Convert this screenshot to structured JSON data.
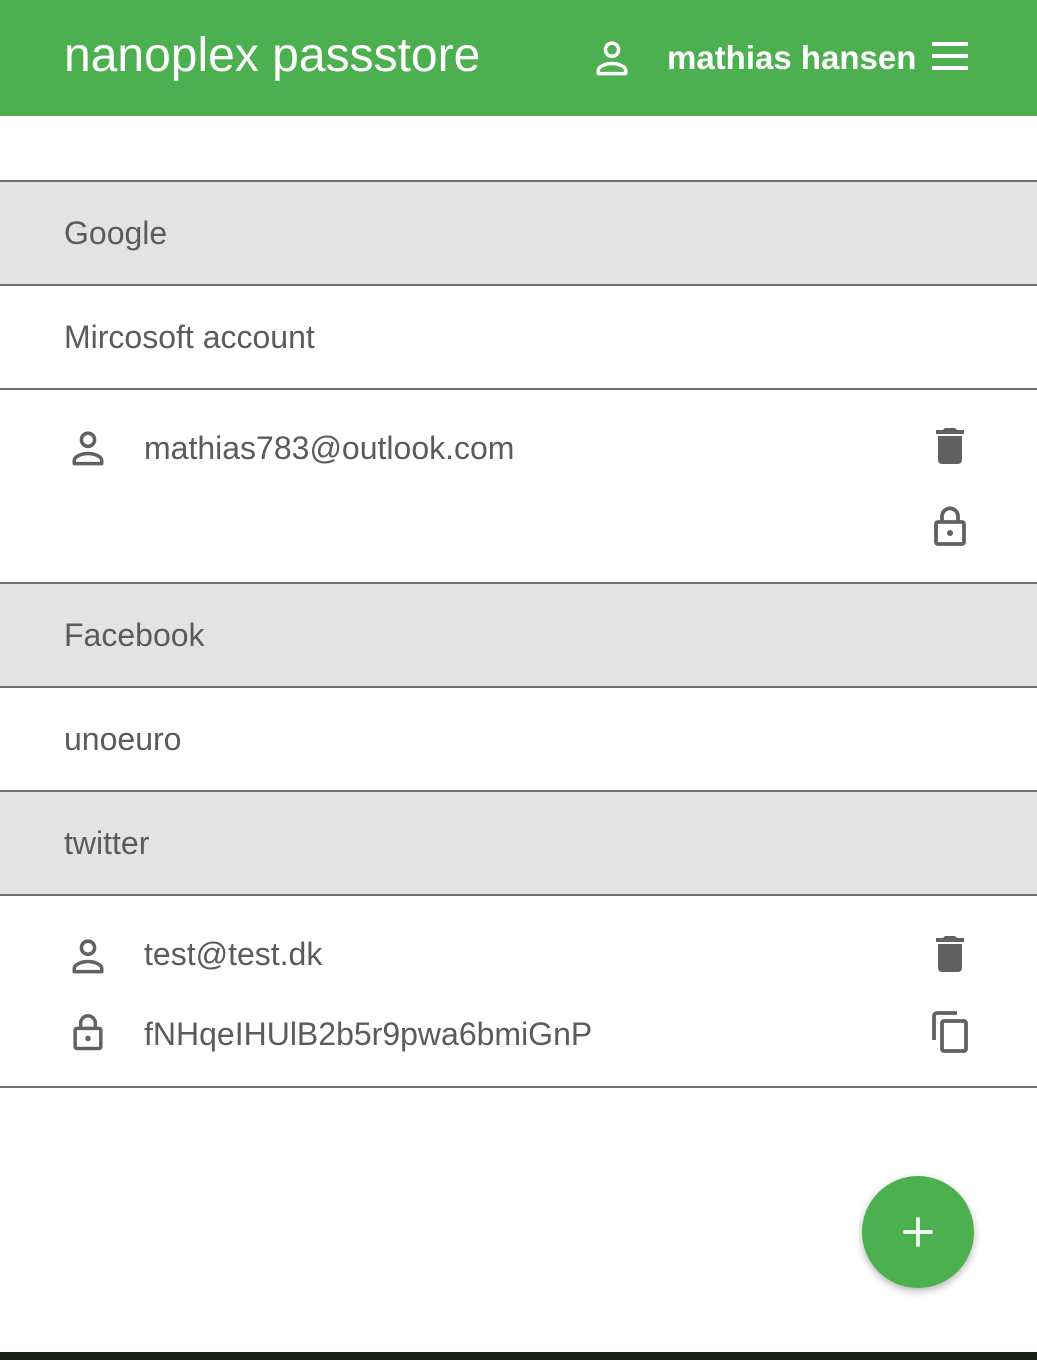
{
  "app": {
    "title": "nanoplex passstore",
    "user_name": "mathias hansen",
    "accent": "#4caf50"
  },
  "icons": {
    "user": "person-outline-icon",
    "menu": "hamburger-menu-icon",
    "delete": "trash-icon",
    "lock": "lock-icon",
    "copy": "copy-icon",
    "add": "plus-icon"
  },
  "entries": [
    {
      "label": "Google",
      "expanded": false
    },
    {
      "label": "Mircosoft account",
      "expanded": true,
      "username": "mathias783@outlook.com",
      "password": ""
    },
    {
      "label": "Facebook",
      "expanded": false
    },
    {
      "label": "unoeuro",
      "expanded": false
    },
    {
      "label": "twitter",
      "expanded": true,
      "username": "test@test.dk",
      "password": "fNHqeIHUlB2b5r9pwa6bmiGnP"
    }
  ]
}
